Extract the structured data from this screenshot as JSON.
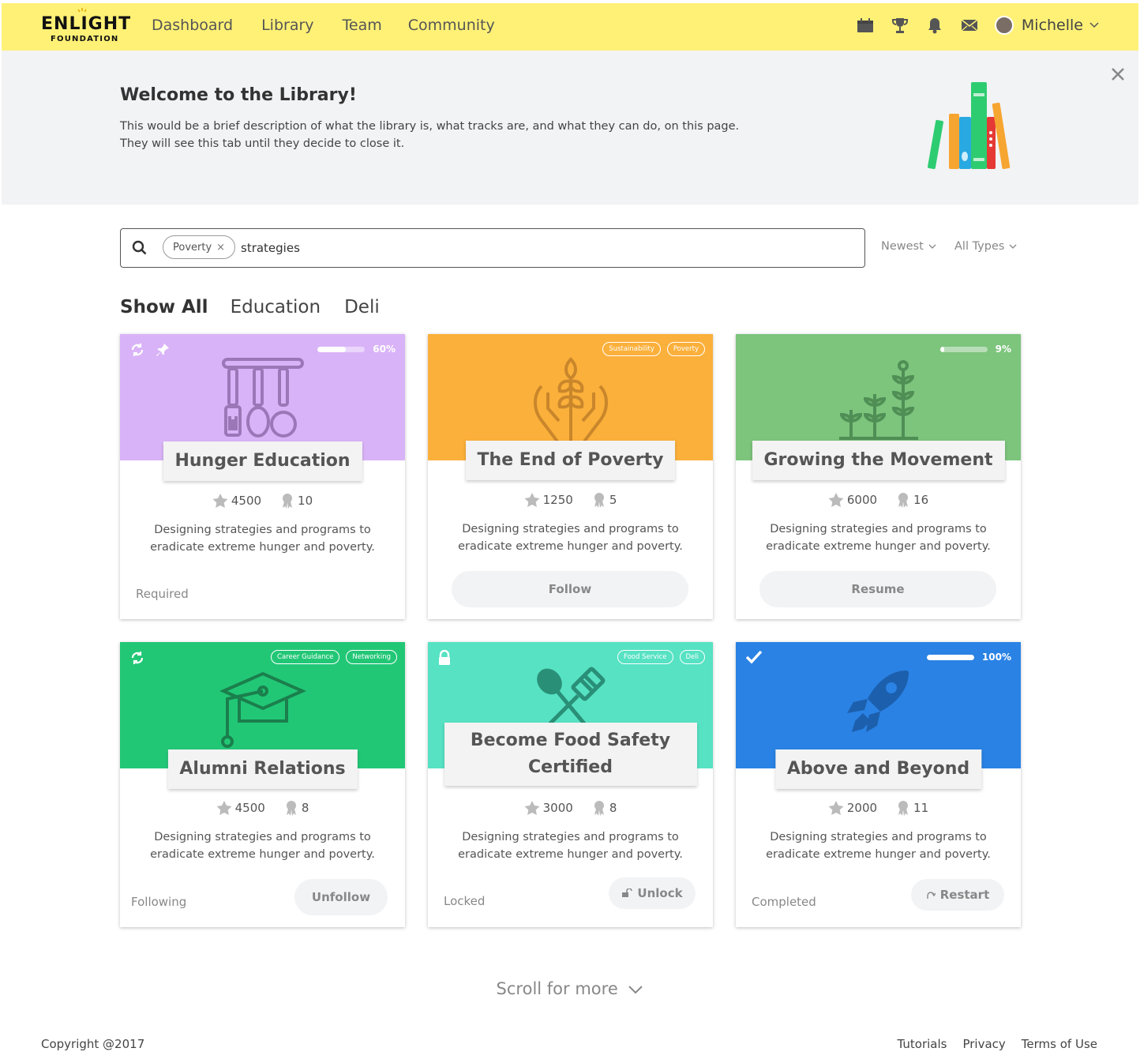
{
  "header": {
    "logo_line1": "ENLIGHT",
    "logo_line2": "FOUNDATION",
    "nav": [
      "Dashboard",
      "Library",
      "Team",
      "Community"
    ],
    "user_name": "Michelle"
  },
  "banner": {
    "title": "Welcome to the Library!",
    "line1": "This would be a brief description of what the library is, what tracks are, and what they can do, on this page.",
    "line2": "They will see this tab until they decide to close it."
  },
  "search": {
    "chip": "Poverty",
    "query": "strategies",
    "sort": "Newest",
    "type": "All Types"
  },
  "tabs": [
    "Show All",
    "Education",
    "Deli"
  ],
  "colors": {
    "header": "#fff176",
    "purple": "#d9b3f7",
    "orange": "#fbb03b",
    "green": "#7dc47d",
    "emerald": "#22c776",
    "teal": "#56e2c3",
    "blue": "#2a82e4"
  },
  "cards": [
    {
      "title": "Hunger Education",
      "stars": "4500",
      "trophies": "10",
      "desc": "Designing strategies and programs to eradicate extreme hunger and poverty.",
      "progress_pct": "60%",
      "progress": 0.6,
      "status": "Required",
      "icon": "kitchen-utensils-icon"
    },
    {
      "title": "The End of Poverty",
      "stars": "1250",
      "trophies": "5",
      "desc": "Designing strategies and programs to eradicate extreme hunger and poverty.",
      "tags": [
        "Sustainability",
        "Poverty"
      ],
      "button": "Follow",
      "icon": "wheat-hands-icon"
    },
    {
      "title": "Growing the Movement",
      "stars": "6000",
      "trophies": "16",
      "desc": "Designing strategies and programs to eradicate extreme hunger and poverty.",
      "progress_pct": "9%",
      "progress": 0.09,
      "button": "Resume",
      "icon": "plants-icon"
    },
    {
      "title": "Alumni Relations",
      "stars": "4500",
      "trophies": "8",
      "desc": "Designing strategies and programs to eradicate extreme hunger and poverty.",
      "tags": [
        "Career Guidance",
        "Networking"
      ],
      "status": "Following",
      "button": "Unfollow",
      "icon": "graduation-cap-icon"
    },
    {
      "title": "Become Food Safety Certified",
      "stars": "3000",
      "trophies": "8",
      "desc": "Designing strategies and programs to eradicate extreme hunger and poverty.",
      "tags": [
        "Food Service",
        "Deli"
      ],
      "status": "Locked",
      "button": "Unlock",
      "icon": "spoon-spatula-icon"
    },
    {
      "title": "Above and Beyond",
      "stars": "2000",
      "trophies": "11",
      "desc": "Designing strategies and programs to eradicate extreme hunger and poverty.",
      "progress_pct": "100%",
      "progress": 1.0,
      "status": "Completed",
      "button": "Restart",
      "icon": "rocket-icon"
    }
  ],
  "scroll_more": "Scroll for more",
  "footer": {
    "copyright": "Copyright @2017",
    "links": [
      "Tutorials",
      "Privacy",
      "Terms of Use"
    ]
  }
}
